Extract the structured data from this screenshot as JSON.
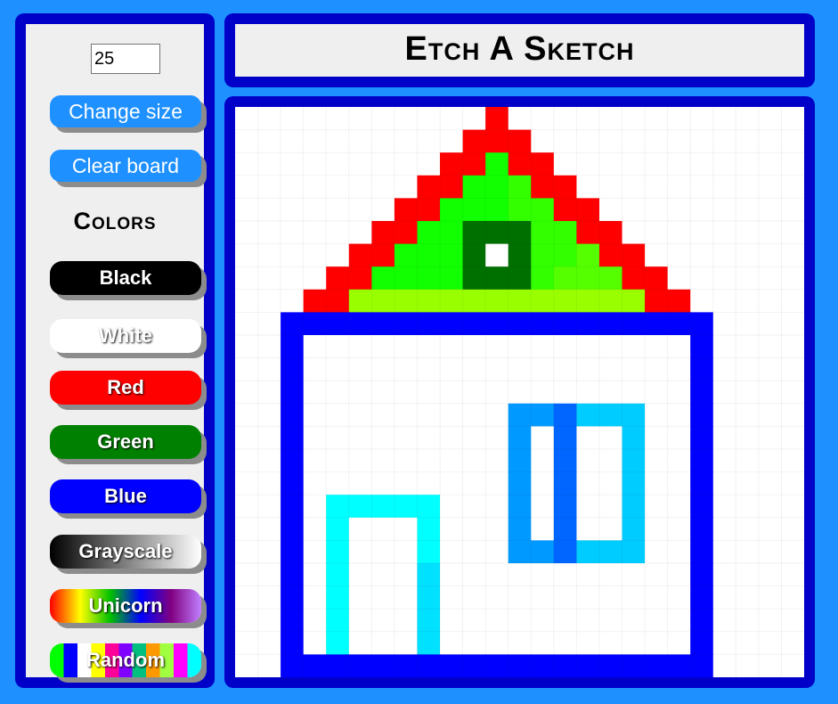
{
  "title": "Etch A Sketch",
  "size_input": {
    "value": "25"
  },
  "buttons": {
    "change_size": "Change size",
    "clear_board": "Clear board"
  },
  "colors_heading": "Colors",
  "colors": [
    {
      "label": "Black",
      "color": "#000000"
    },
    {
      "label": "White",
      "color": "#ffffff"
    },
    {
      "label": "Red",
      "color": "#ff0000"
    },
    {
      "label": "Green",
      "color": "#008000"
    },
    {
      "label": "Blue",
      "color": "#0000ff"
    },
    {
      "label": "Grayscale",
      "gradient": [
        "#000000",
        "#ffffff"
      ]
    },
    {
      "label": "Unicorn",
      "gradient": [
        "#ff0000",
        "#ffff00",
        "#00c000",
        "#0000ff",
        "#800080",
        "#c080ff"
      ]
    },
    {
      "label": "Random",
      "stripes": [
        "#00ff00",
        "#0000ff",
        "#ffffff",
        "#ffff00",
        "#ff0099",
        "#8000ff",
        "#00c080",
        "#ff9900",
        "#a0ff40",
        "#ff00ff",
        "#00ffff"
      ]
    }
  ],
  "theme": {
    "background": "#1e90ff",
    "panel_border": "#0000c8",
    "panel_fill": "#efefef",
    "button_blue": "#1e90ff",
    "shadow": "#8c8c8c"
  },
  "drawing": {
    "grid_size": 25,
    "cell_colors": {
      "R": "#ff0000",
      "G": "#11ff00",
      "L": "#33ff00",
      "M": "#55ff00",
      "Y": "#99ff00",
      "D": "#007000",
      "W": "#ffffff",
      "B": "#0000ff",
      "C": "#00ffff",
      "c": "#00e0ff",
      "S": "#0099ff",
      "s": "#00ccff",
      "N": "#0066ff"
    },
    "rows": [
      "...........R.............",
      "..........RRR............",
      ".........RRGRR...........",
      "........RRGGLRR..........",
      ".......RRGGGLLRR.........",
      "......RRGGDDDLLRR........",
      ".....RRGGGDWDLLMRR.......",
      "....RRGGGGDDDLMMMRR......",
      "...RRYYYYYYYYYYYYYRR.....",
      "..BBBBBBBBBBBBBBBBBBB....",
      "..B.................B....",
      "..B.................B....",
      "..B.................B....",
      "..B.........SSNsss..B....",
      "..B.........S.N..s..B....",
      "..B.........S.N..s..B....",
      "..B.........S.N..s..B....",
      "..B.CCCCC...S.N..s..B....",
      "..B.C...C...S.N..s..B....",
      "..B.C...C...SSNsss..B....",
      "..B.C...c...........B....",
      "..B.C...c...........B....",
      "..B.C...c...........B....",
      "..B.C...c...........B....",
      "..BBBBBBBBBBBBBBBBBBB...."
    ]
  }
}
